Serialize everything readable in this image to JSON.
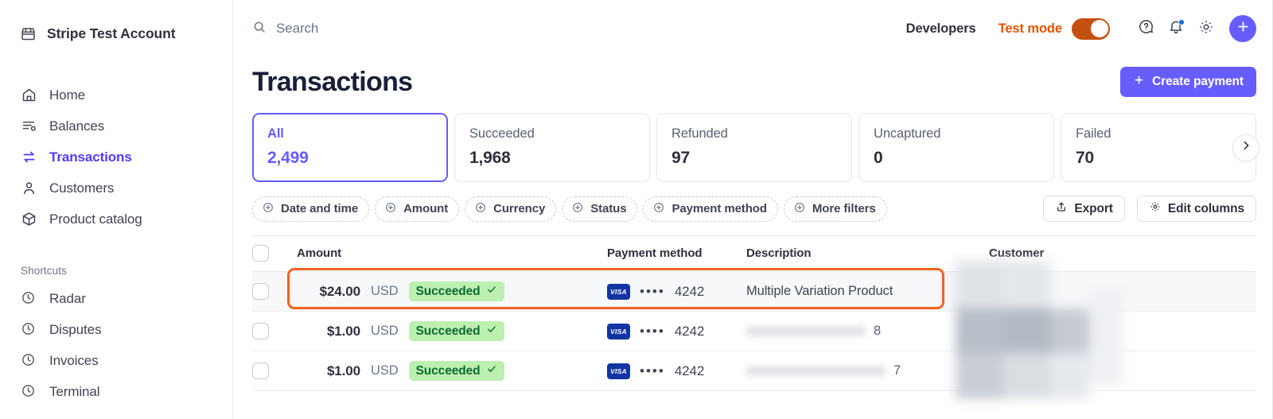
{
  "sidebar": {
    "account": {
      "name": "Stripe Test Account",
      "icon": "store-icon"
    },
    "items": [
      {
        "label": "Home",
        "icon": "home-icon",
        "active": false
      },
      {
        "label": "Balances",
        "icon": "balances-icon",
        "active": false
      },
      {
        "label": "Transactions",
        "icon": "transactions-icon",
        "active": true
      },
      {
        "label": "Customers",
        "icon": "customers-icon",
        "active": false
      },
      {
        "label": "Product catalog",
        "icon": "product-catalog-icon",
        "active": false
      }
    ],
    "shortcuts_title": "Shortcuts",
    "shortcuts": [
      {
        "label": "Radar",
        "icon": "clock-icon"
      },
      {
        "label": "Disputes",
        "icon": "clock-icon"
      },
      {
        "label": "Invoices",
        "icon": "clock-icon"
      },
      {
        "label": "Terminal",
        "icon": "clock-icon"
      }
    ]
  },
  "topbar": {
    "search_placeholder": "Search",
    "search_icon": "search-icon",
    "developers_label": "Developers",
    "test_mode_label": "Test mode",
    "test_mode_on": true,
    "help_icon": "help-icon",
    "notifications_icon": "bell-icon",
    "settings_icon": "gear-icon",
    "add_icon": "plus-icon"
  },
  "page": {
    "title": "Transactions",
    "create_button": "Create payment",
    "create_button_icon": "plus-icon"
  },
  "stats": [
    {
      "label": "All",
      "value": "2,499",
      "selected": true
    },
    {
      "label": "Succeeded",
      "value": "1,968",
      "selected": false
    },
    {
      "label": "Refunded",
      "value": "97",
      "selected": false
    },
    {
      "label": "Uncaptured",
      "value": "0",
      "selected": false
    },
    {
      "label": "Failed",
      "value": "70",
      "selected": false
    }
  ],
  "stats_next_icon": "chevron-right-icon",
  "filters": {
    "chips": [
      {
        "label": "Date and time",
        "icon": "plus-circle-icon"
      },
      {
        "label": "Amount",
        "icon": "plus-circle-icon"
      },
      {
        "label": "Currency",
        "icon": "plus-circle-icon"
      },
      {
        "label": "Status",
        "icon": "plus-circle-icon"
      },
      {
        "label": "Payment method",
        "icon": "plus-circle-icon"
      },
      {
        "label": "More filters",
        "icon": "plus-circle-icon"
      }
    ],
    "export_label": "Export",
    "export_icon": "export-icon",
    "edit_columns_label": "Edit columns",
    "edit_columns_icon": "gear-icon"
  },
  "table": {
    "columns": [
      "Amount",
      "Payment method",
      "Description",
      "Customer"
    ],
    "rows": [
      {
        "amount": "$24.00",
        "currency": "USD",
        "status": "Succeeded",
        "status_icon": "check-icon",
        "card_brand": "VISA",
        "card_mask": "••••",
        "card_last4": "4242",
        "description": "Multiple Variation Product",
        "description_redacted": false,
        "customer_redacted": true,
        "highlighted": true
      },
      {
        "amount": "$1.00",
        "currency": "USD",
        "status": "Succeeded",
        "status_icon": "check-icon",
        "card_brand": "VISA",
        "card_mask": "••••",
        "card_last4": "4242",
        "description": "8",
        "description_redacted": true,
        "customer_redacted": true,
        "highlighted": false
      },
      {
        "amount": "$1.00",
        "currency": "USD",
        "status": "Succeeded",
        "status_icon": "check-icon",
        "card_brand": "VISA",
        "card_mask": "••••",
        "card_last4": "4242",
        "description": "7",
        "description_redacted": true,
        "customer_redacted": true,
        "highlighted": false
      }
    ]
  },
  "colors": {
    "accent_purple": "#675dff",
    "test_mode_orange": "#e25300",
    "highlight_orange": "#f26322",
    "success_green_bg": "#bdf0b0",
    "success_green_text": "#0b6b30",
    "visa_blue": "#1434a4"
  }
}
